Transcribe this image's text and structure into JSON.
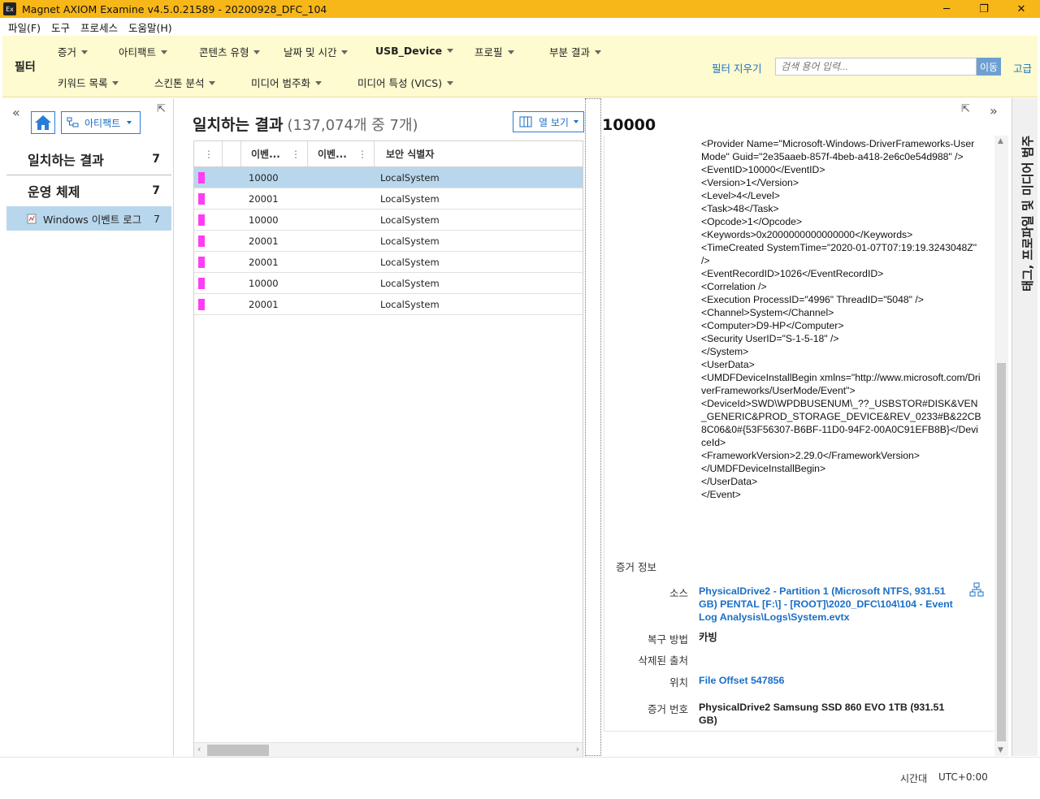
{
  "window": {
    "title": "Magnet AXIOM Examine v4.5.0.21589 - 20200928_DFC_104",
    "app_icon_text": "Ex",
    "minimize": "─",
    "maximize": "❐",
    "close": "✕"
  },
  "menu": [
    "파일(F)",
    "도구",
    "프로세스",
    "도움말(H)"
  ],
  "filterbar": {
    "label": "필터",
    "items_row1": [
      "증거",
      "아티팩트",
      "콘텐츠 유형",
      "날짜 및 시간",
      "USB_Device",
      "프로필",
      "부분 결과"
    ],
    "items_row2": [
      "키워드 목록",
      "스킨톤 분석",
      "미디어 범주화",
      "미디어 특성 (VICS)"
    ],
    "clear_filters": "필터 지우기",
    "search_placeholder": "검색 용어 입력...",
    "go": "이동",
    "advanced": "고급"
  },
  "leftpanel": {
    "collapse": "«",
    "pin": "⇱",
    "artifact_dropdown": "아티팩트",
    "nav": [
      {
        "label": "일치하는 결과",
        "count": "7"
      },
      {
        "label": "운영 체제",
        "count": "7"
      }
    ],
    "sub_item": {
      "label": "Windows 이벤트 로그",
      "count": "7"
    }
  },
  "midpanel": {
    "title": "일치하는 결과",
    "count_text": "(137,074개 중 7개)",
    "column_view": "열 보기",
    "columns": [
      "이벤...",
      "이벤...",
      "보안 식별자"
    ],
    "rows": [
      {
        "event_id": "10000",
        "sid": "LocalSystem",
        "selected": true
      },
      {
        "event_id": "20001",
        "sid": "LocalSystem",
        "selected": false
      },
      {
        "event_id": "10000",
        "sid": "LocalSystem",
        "selected": false
      },
      {
        "event_id": "20001",
        "sid": "LocalSystem",
        "selected": false
      },
      {
        "event_id": "20001",
        "sid": "LocalSystem",
        "selected": false
      },
      {
        "event_id": "10000",
        "sid": "LocalSystem",
        "selected": false
      },
      {
        "event_id": "20001",
        "sid": "LocalSystem",
        "selected": false
      }
    ]
  },
  "rightpanel": {
    "title": "10000",
    "pin": "⇱",
    "collapse": "»",
    "xml": "<Provider Name=\"Microsoft-Windows-DriverFrameworks-UserMode\" Guid=\"2e35aaeb-857f-4beb-a418-2e6c0e54d988\" />\n<EventID>10000</EventID>\n<Version>1</Version>\n<Level>4</Level>\n<Task>48</Task>\n<Opcode>1</Opcode>\n<Keywords>0x2000000000000000</Keywords>\n<TimeCreated SystemTime=\"2020-01-07T07:19:19.3243048Z\" />\n<EventRecordID>1026</EventRecordID>\n<Correlation />\n<Execution ProcessID=\"4996\" ThreadID=\"5048\" />\n<Channel>System</Channel>\n<Computer>D9-HP</Computer>\n<Security UserID=\"S-1-5-18\" />\n</System>\n<UserData>\n<UMDFDeviceInstallBegin xmlns=\"http://www.microsoft.com/DriverFrameworks/UserMode/Event\">\n<DeviceId>SWD\\WPDBUSENUM\\_??_USBSTOR#DISK&VEN_GENERIC&PROD_STORAGE_DEVICE&REV_0233#B&22CB8C06&0#{53F56307-B6BF-11D0-94F2-00A0C91EFB8B}</DeviceId>\n<FrameworkVersion>2.29.0</FrameworkVersion>\n</UMDFDeviceInstallBegin>\n</UserData>\n</Event>",
    "evidence_title": "증거 정보",
    "evidence": [
      {
        "label": "소스",
        "value": "PhysicalDrive2 - Partition 1 (Microsoft NTFS, 931.51 GB) PENTAL [F:\\] - [ROOT]\\2020_DFC\\104\\104 - Event Log Analysis\\Logs\\System.evtx",
        "link": true
      },
      {
        "label": "복구 방법",
        "value": "카빙",
        "link": false
      },
      {
        "label": "삭제된 출처",
        "value": "",
        "link": false
      },
      {
        "label": "위치",
        "value": "File Offset 547856",
        "link": true
      },
      {
        "label": "증거 번호",
        "value": "PhysicalDrive2 Samsung SSD 860 EVO 1TB (931.51 GB)",
        "link": false
      }
    ]
  },
  "vtab": {
    "label": "태그, 프로파일 및 미디어 범주"
  },
  "status": {
    "tz_label": "시간대",
    "tz_value": "UTC+0:00"
  },
  "colors": {
    "accent": "#f7b718",
    "filter_bg": "#fdfbcf",
    "selection": "#b9d7ec",
    "link": "#1a6fc6",
    "tag": "#ff3df5"
  }
}
